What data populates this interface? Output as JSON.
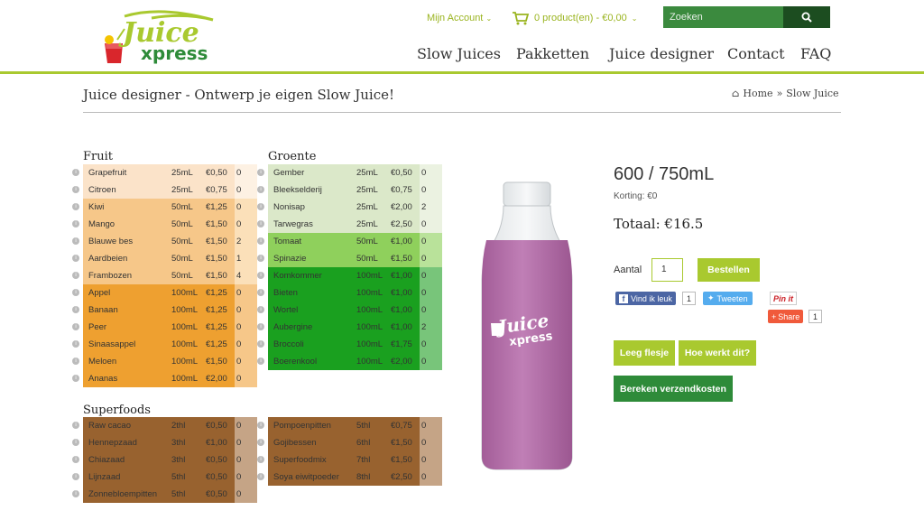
{
  "header": {
    "logo_text_1": "Juice",
    "logo_text_2": "xpress",
    "account_label": "Mijn Account",
    "cart_label": "0 product(en) - €0,00",
    "search_placeholder": "Zoeken",
    "nav": [
      "Slow Juices",
      "Pakketten",
      "Juice designer",
      "Contact",
      "FAQ"
    ]
  },
  "page": {
    "title": "Juice designer - Ontwerp je eigen Slow Juice!",
    "breadcrumb_home": "Home",
    "breadcrumb_sep": "»",
    "breadcrumb_current": "Slow Juice"
  },
  "sections": {
    "fruit": "Fruit",
    "groente": "Groente",
    "superfoods": "Superfoods"
  },
  "fruit": [
    {
      "name": "Grapefruit",
      "ml": "25mL",
      "price": "€0,50",
      "qty": "0"
    },
    {
      "name": "Citroen",
      "ml": "25mL",
      "price": "€0,75",
      "qty": "0"
    },
    {
      "name": "Kiwi",
      "ml": "50mL",
      "price": "€1,25",
      "qty": "0"
    },
    {
      "name": "Mango",
      "ml": "50mL",
      "price": "€1,50",
      "qty": "0"
    },
    {
      "name": "Blauwe bes",
      "ml": "50mL",
      "price": "€1,50",
      "qty": "2"
    },
    {
      "name": "Aardbeien",
      "ml": "50mL",
      "price": "€1,50",
      "qty": "1"
    },
    {
      "name": "Frambozen",
      "ml": "50mL",
      "price": "€1,50",
      "qty": "4"
    },
    {
      "name": "Appel",
      "ml": "100mL",
      "price": "€1,25",
      "qty": "0"
    },
    {
      "name": "Banaan",
      "ml": "100mL",
      "price": "€1,25",
      "qty": "0"
    },
    {
      "name": "Peer",
      "ml": "100mL",
      "price": "€1,25",
      "qty": "0"
    },
    {
      "name": "Sinaasappel",
      "ml": "100mL",
      "price": "€1,25",
      "qty": "0"
    },
    {
      "name": "Meloen",
      "ml": "100mL",
      "price": "€1,50",
      "qty": "0"
    },
    {
      "name": "Ananas",
      "ml": "100mL",
      "price": "€2,00",
      "qty": "0"
    }
  ],
  "groente": [
    {
      "name": "Gember",
      "ml": "25mL",
      "price": "€0,50",
      "qty": "0"
    },
    {
      "name": "Bleekselderij",
      "ml": "25mL",
      "price": "€0,75",
      "qty": "0"
    },
    {
      "name": "Nonisap",
      "ml": "25mL",
      "price": "€2,00",
      "qty": "2"
    },
    {
      "name": "Tarwegras",
      "ml": "25mL",
      "price": "€2,50",
      "qty": "0"
    },
    {
      "name": "Tomaat",
      "ml": "50mL",
      "price": "€1,00",
      "qty": "0"
    },
    {
      "name": "Spinazie",
      "ml": "50mL",
      "price": "€1,50",
      "qty": "0"
    },
    {
      "name": "Komkommer",
      "ml": "100mL",
      "price": "€1,00",
      "qty": "0"
    },
    {
      "name": "Bieten",
      "ml": "100mL",
      "price": "€1,00",
      "qty": "0"
    },
    {
      "name": "Wortel",
      "ml": "100mL",
      "price": "€1,00",
      "qty": "0"
    },
    {
      "name": "Aubergine",
      "ml": "100mL",
      "price": "€1,00",
      "qty": "2"
    },
    {
      "name": "Broccoli",
      "ml": "100mL",
      "price": "€1,75",
      "qty": "0"
    },
    {
      "name": "Boerenkool",
      "ml": "100mL",
      "price": "€2,00",
      "qty": "0"
    }
  ],
  "superfoods_left": [
    {
      "name": "Raw cacao",
      "ml": "2thl",
      "price": "€0,50",
      "qty": "0"
    },
    {
      "name": "Hennepzaad",
      "ml": "3thl",
      "price": "€1,00",
      "qty": "0"
    },
    {
      "name": "Chiazaad",
      "ml": "3thl",
      "price": "€0,50",
      "qty": "0"
    },
    {
      "name": "Lijnzaad",
      "ml": "5thl",
      "price": "€0,50",
      "qty": "0"
    },
    {
      "name": "Zonnebloempitten",
      "ml": "5thl",
      "price": "€0,50",
      "qty": "0"
    }
  ],
  "superfoods_right": [
    {
      "name": "Pompoenpitten",
      "ml": "5thl",
      "price": "€0,75",
      "qty": "0"
    },
    {
      "name": "Gojibessen",
      "ml": "6thl",
      "price": "€1,50",
      "qty": "0"
    },
    {
      "name": "Superfoodmix",
      "ml": "7thl",
      "price": "€1,50",
      "qty": "0"
    },
    {
      "name": "Soya eiwitpoeder",
      "ml": "8thl",
      "price": "€2,50",
      "qty": "0"
    }
  ],
  "product": {
    "size": "600 / 750mL",
    "korting": "Korting: €0",
    "totaal": "Totaal: €16.5",
    "aantal_label": "Aantal",
    "aantal_value": "1",
    "bestellen": "Bestellen",
    "leeg": "Leeg flesje",
    "hoe": "Hoe werkt dit?",
    "bereken": "Bereken verzendkosten",
    "liquid_color": "#c07fb6"
  },
  "social": {
    "fb_label": "Vind ik leuk",
    "fb_count": "1",
    "tw_label": "Tweeten",
    "pin_label": "Pin it",
    "share_label": "Share",
    "share_count": "1"
  },
  "colors": {
    "accent": "#a9c92f",
    "dark_green": "#2e8b39",
    "search_bg": "#3b8a3e"
  }
}
